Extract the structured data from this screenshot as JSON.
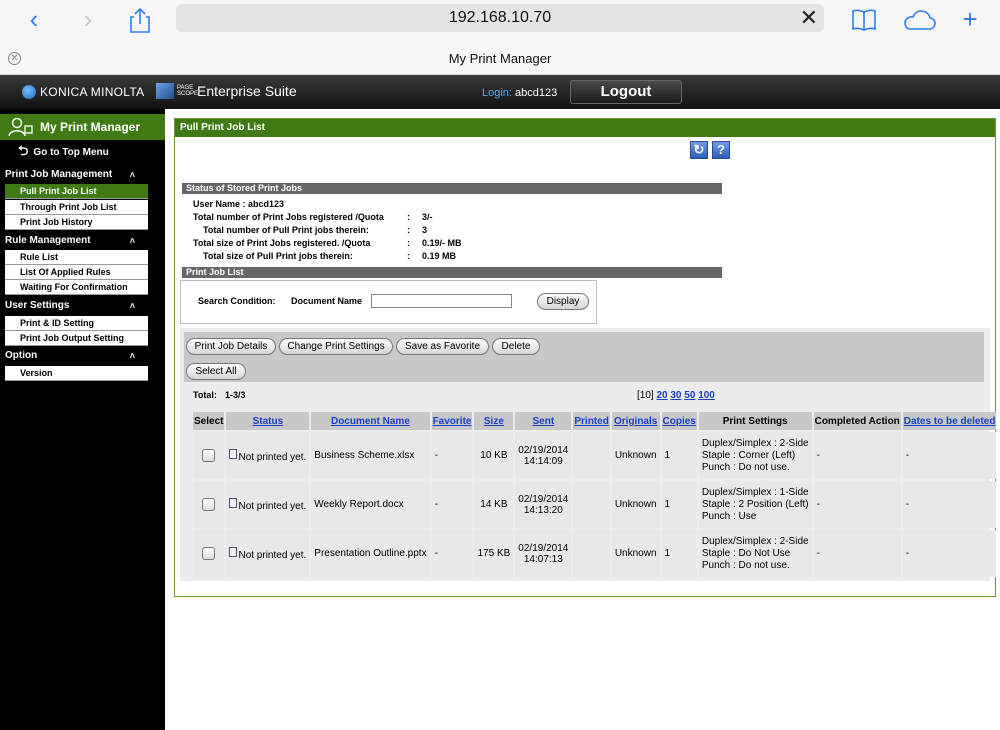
{
  "browser": {
    "url": "192.168.10.70",
    "tab_title": "My Print Manager"
  },
  "header": {
    "brand": "KONICA MINOLTA",
    "suite_small": "PAGE SCOPE",
    "suite": "Enterprise Suite",
    "login_label": "Login:",
    "login_user": "abcd123",
    "logout": "Logout"
  },
  "sidebar": {
    "title": "My Print Manager",
    "top_menu": "Go to Top Menu",
    "sections": [
      {
        "label": "Print Job Management",
        "items": [
          "Pull Print Job List",
          "Through Print Job List",
          "Print Job History"
        ]
      },
      {
        "label": "Rule Management",
        "items": [
          "Rule List",
          "List Of Applied Rules",
          "Waiting For Confirmation"
        ]
      },
      {
        "label": "User Settings",
        "items": [
          "Print & ID Setting",
          "Print Job Output Setting"
        ]
      },
      {
        "label": "Option",
        "items": [
          "Version"
        ]
      }
    ]
  },
  "main": {
    "title": "Pull Print Job List",
    "status_title": "Status of Stored Print Jobs",
    "stats": [
      {
        "label": "User Name : abcd123",
        "value": ""
      },
      {
        "label": "Total number of Print Jobs registered /Quota",
        "value": "3/-"
      },
      {
        "label": "Total number of Pull Print jobs therein:",
        "value": "3"
      },
      {
        "label": "Total size of Print Jobs registered. /Quota",
        "value": "0.19/- MB"
      },
      {
        "label": "Total size of Pull Print jobs therein:",
        "value": "0.19 MB"
      }
    ],
    "list_title": "Print Job List",
    "search_label": "Search Condition:",
    "search_field_label": "Document Name",
    "search_value": "",
    "display_btn": "Display",
    "buttons": [
      "Print Job Details",
      "Change Print Settings",
      "Save as Favorite",
      "Delete"
    ],
    "select_all": "Select All",
    "total_label": "Total:",
    "total_value": "1-3/3",
    "pager": {
      "current": "[10]",
      "links": [
        "20",
        "30",
        "50",
        "100"
      ]
    },
    "columns": [
      "Select",
      "Status",
      "Document Name",
      "Favorite",
      "Size",
      "Sent",
      "Printed",
      "Originals",
      "Copies",
      "Print Settings",
      "Completed Action",
      "Dates to be deleted"
    ],
    "rows": [
      {
        "status": "Not printed yet.",
        "doc": "Business Scheme.xlsx",
        "favorite": "-",
        "size": "10 KB",
        "sent_date": "02/19/2014",
        "sent_time": "14:14:09",
        "printed": "",
        "originals": "Unknown",
        "copies": "1",
        "settings": [
          "Duplex/Simplex : 2-Side",
          "Staple : Corner (Left)",
          "Punch : Do not use."
        ],
        "completed": "-",
        "delete": "-"
      },
      {
        "status": "Not printed yet.",
        "doc": "Weekly Report.docx",
        "favorite": "-",
        "size": "14 KB",
        "sent_date": "02/19/2014",
        "sent_time": "14:13:20",
        "printed": "",
        "originals": "Unknown",
        "copies": "1",
        "settings": [
          "Duplex/Simplex : 1-Side",
          "Staple : 2 Position (Left)",
          "Punch : Use"
        ],
        "completed": "-",
        "delete": "-"
      },
      {
        "status": "Not printed yet.",
        "doc": "Presentation Outline.pptx",
        "favorite": "-",
        "size": "175 KB",
        "sent_date": "02/19/2014",
        "sent_time": "14:07:13",
        "printed": "",
        "originals": "Unknown",
        "copies": "1",
        "settings": [
          "Duplex/Simplex : 2-Side",
          "Staple : Do Not Use",
          "Punch : Do not use."
        ],
        "completed": "-",
        "delete": "-"
      }
    ]
  },
  "colors": {
    "brand_green": "#3f7a14",
    "link_blue": "#1a3fc4",
    "safari_blue": "#2f7cf6"
  }
}
